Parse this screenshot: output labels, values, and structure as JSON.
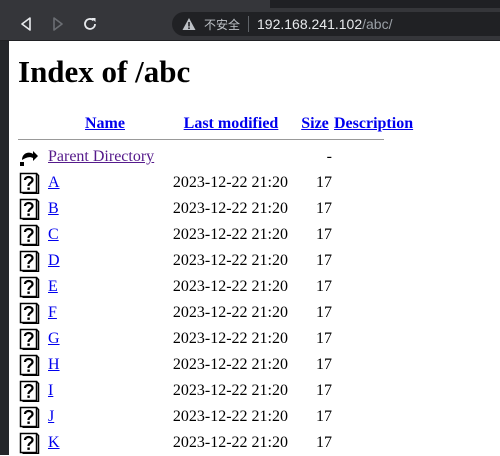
{
  "browser": {
    "security_label": "不安全",
    "url_host": "192.168.241.102",
    "url_path": "/abc/"
  },
  "page": {
    "title": "Index of /abc",
    "columns": {
      "name": "Name",
      "last_modified": "Last modified",
      "size": "Size",
      "description": "Description"
    },
    "parent": {
      "label": "Parent Directory",
      "modified": "",
      "size": "-",
      "description": ""
    },
    "entries": [
      {
        "name": "A",
        "modified": "2023-12-22 21:20",
        "size": "17",
        "description": ""
      },
      {
        "name": "B",
        "modified": "2023-12-22 21:20",
        "size": "17",
        "description": ""
      },
      {
        "name": "C",
        "modified": "2023-12-22 21:20",
        "size": "17",
        "description": ""
      },
      {
        "name": "D",
        "modified": "2023-12-22 21:20",
        "size": "17",
        "description": ""
      },
      {
        "name": "E",
        "modified": "2023-12-22 21:20",
        "size": "17",
        "description": ""
      },
      {
        "name": "F",
        "modified": "2023-12-22 21:20",
        "size": "17",
        "description": ""
      },
      {
        "name": "G",
        "modified": "2023-12-22 21:20",
        "size": "17",
        "description": ""
      },
      {
        "name": "H",
        "modified": "2023-12-22 21:20",
        "size": "17",
        "description": ""
      },
      {
        "name": "I",
        "modified": "2023-12-22 21:20",
        "size": "17",
        "description": ""
      },
      {
        "name": "J",
        "modified": "2023-12-22 21:20",
        "size": "17",
        "description": ""
      },
      {
        "name": "K",
        "modified": "2023-12-22 21:20",
        "size": "17",
        "description": ""
      }
    ]
  }
}
